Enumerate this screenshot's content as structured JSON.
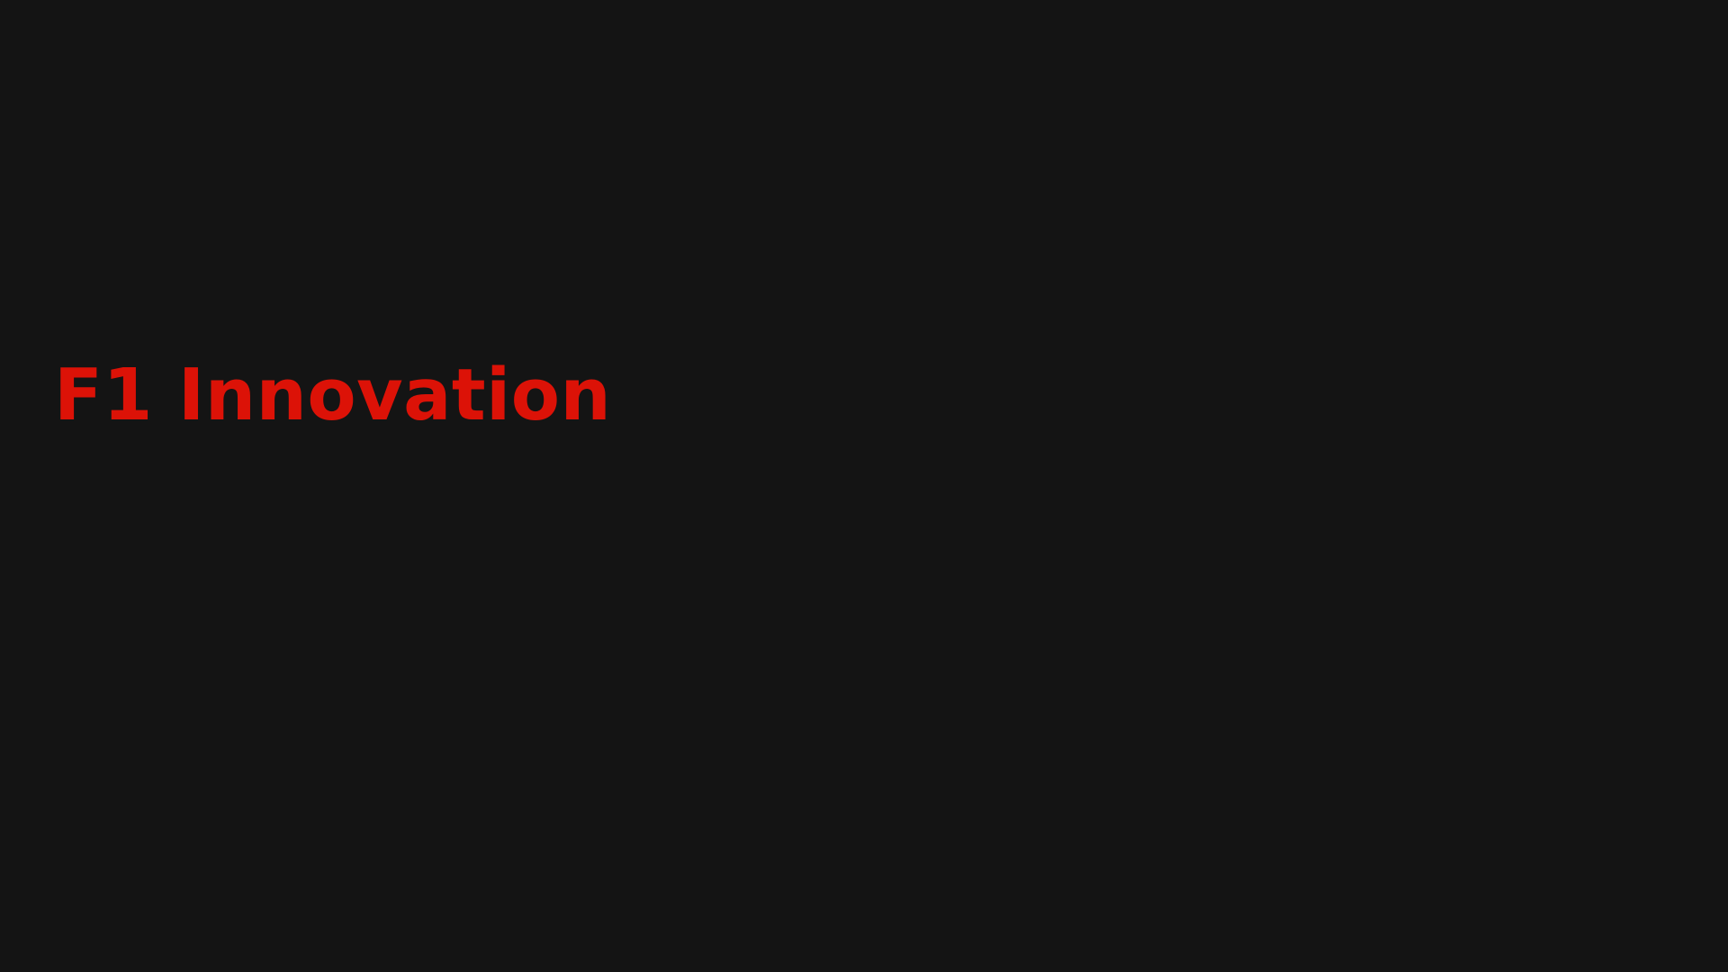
{
  "slide": {
    "title": "F1 Innovation",
    "background_color": "#141414",
    "title_color": "#dc1207"
  }
}
